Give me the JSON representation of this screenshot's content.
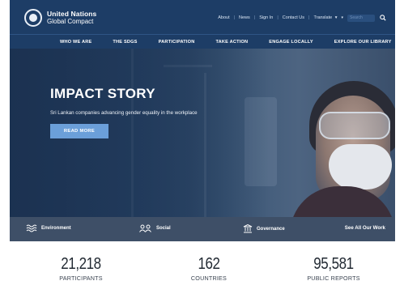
{
  "brand": {
    "line1": "United Nations",
    "line2": "Global Compact"
  },
  "utility": {
    "about": "About",
    "news": "News",
    "signin": "Sign In",
    "contact": "Contact Us",
    "translate": "Translate",
    "search_placeholder": "Search"
  },
  "nav": [
    "WHO WE ARE",
    "THE SDGS",
    "PARTICIPATION",
    "TAKE ACTION",
    "ENGAGE LOCALLY",
    "EXPLORE OUR LIBRARY"
  ],
  "hero": {
    "title": "IMPACT STORY",
    "subtitle": "Sri Lankan companies advancing gender equality in the workplace",
    "button": "READ MORE"
  },
  "pillars": {
    "environment": "Environment",
    "social": "Social",
    "governance": "Governance",
    "see_all": "See All Our Work"
  },
  "stats": [
    {
      "value": "21,218",
      "label": "PARTICIPANTS"
    },
    {
      "value": "162",
      "label": "COUNTRIES"
    },
    {
      "value": "95,581",
      "label": "PUBLIC REPORTS"
    }
  ],
  "colors": {
    "header": "#1d3d66",
    "accent_button": "#6b9fd9"
  },
  "icons": [
    "un-emblem-icon",
    "search-icon",
    "chevron-down-icon",
    "waves-icon",
    "people-icon",
    "institution-icon"
  ]
}
